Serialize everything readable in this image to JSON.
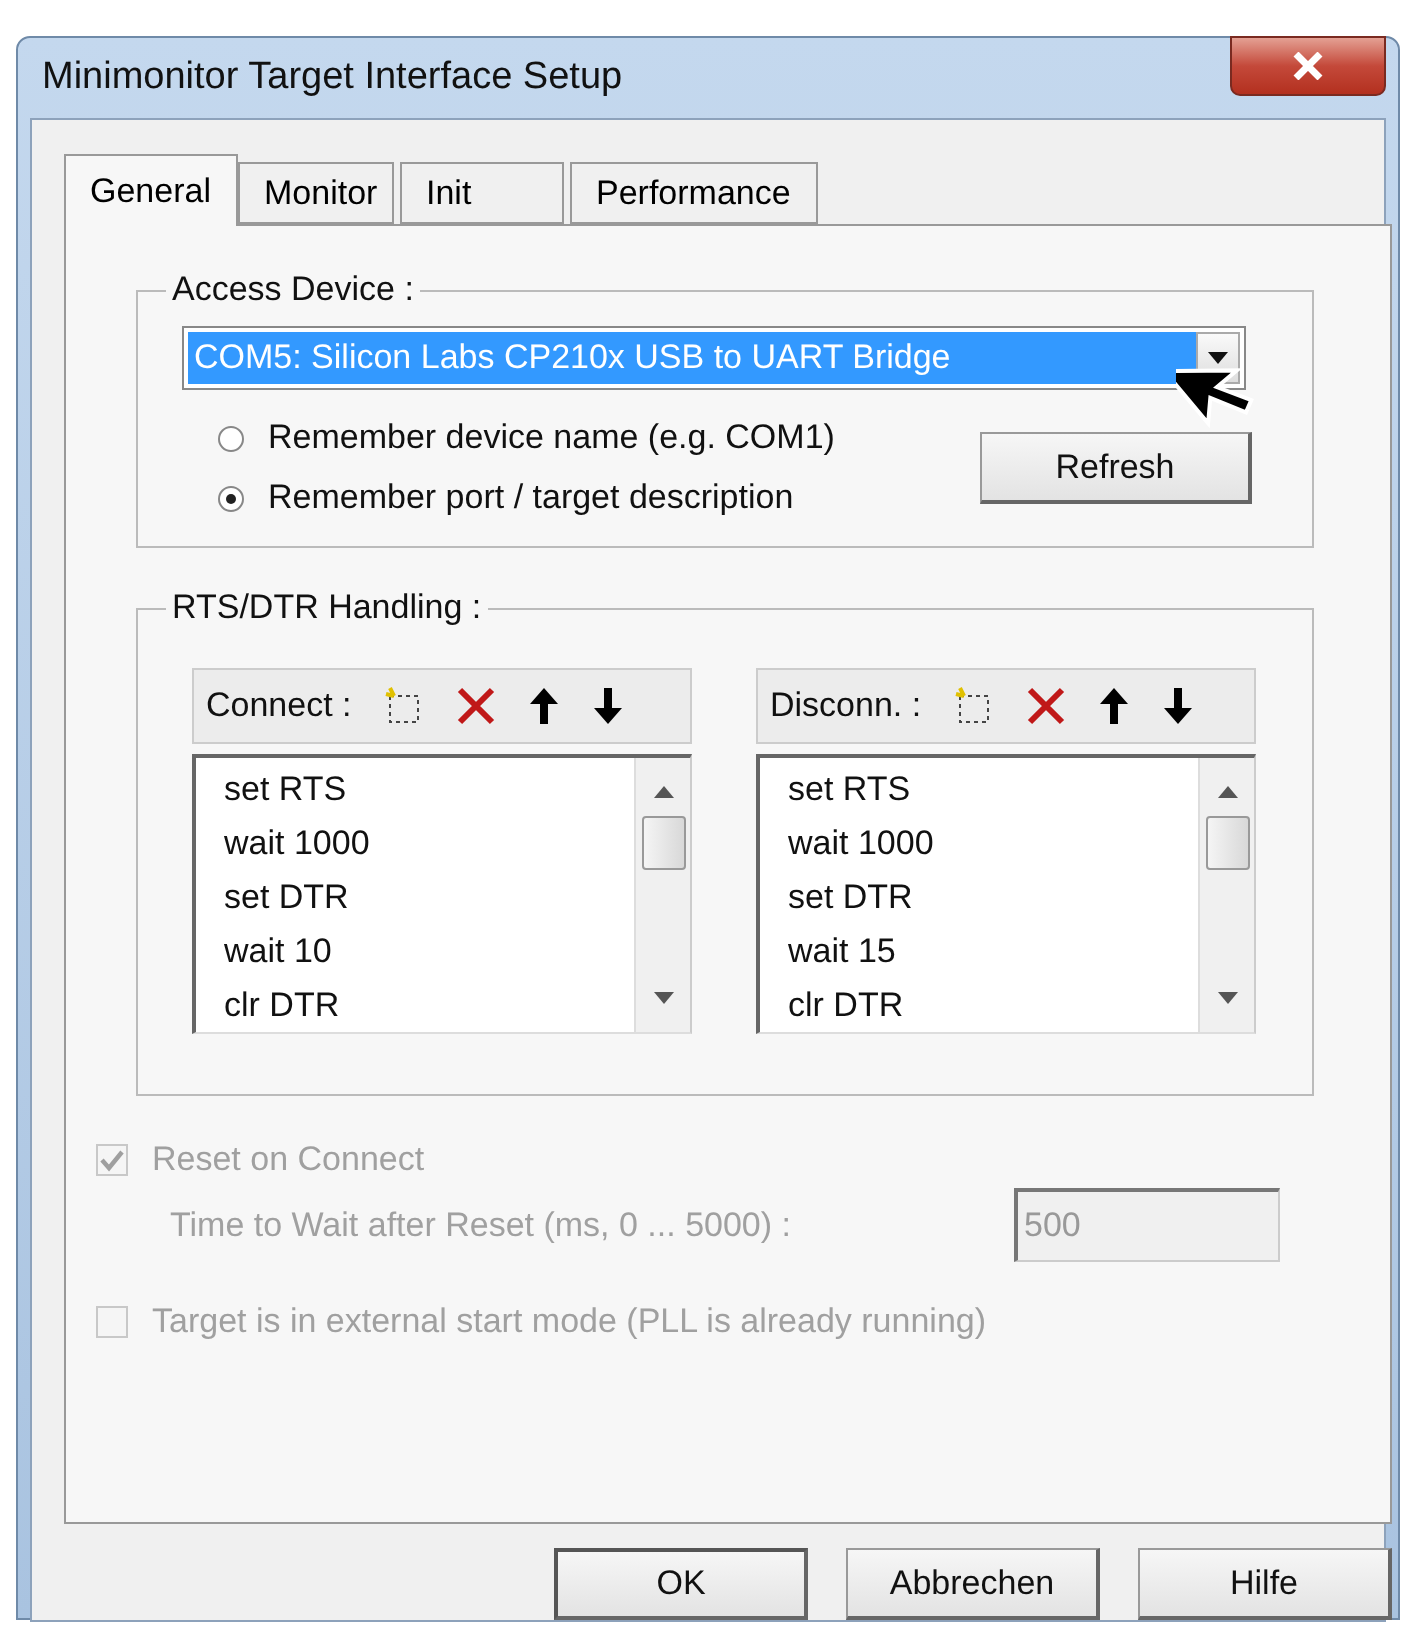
{
  "window": {
    "title": "Minimonitor Target Interface Setup"
  },
  "tabs": [
    {
      "label": "General",
      "selected": true
    },
    {
      "label": "Monitor",
      "selected": false
    },
    {
      "label": "Init",
      "selected": false
    },
    {
      "label": "Performance",
      "selected": false
    }
  ],
  "access_device": {
    "label": "Access Device :",
    "device": "COM5: Silicon Labs CP210x USB to UART Bridge",
    "radios": [
      {
        "label": "Remember device name (e.g. COM1)",
        "selected": false
      },
      {
        "label": "Remember port / target description",
        "selected": true
      }
    ],
    "refresh_button": "Refresh"
  },
  "rts_dtr": {
    "label": "RTS/DTR Handling :",
    "lists": [
      {
        "label": "Connect :",
        "items": [
          "set RTS",
          "wait 1000",
          "set DTR",
          "wait 10",
          "clr DTR"
        ]
      },
      {
        "label": "Disconn. :",
        "items": [
          "set RTS",
          "wait 1000",
          "set DTR",
          "wait 15",
          "clr DTR"
        ]
      }
    ]
  },
  "reset_on_connect": {
    "label": "Reset on Connect",
    "checked": true,
    "disabled": true
  },
  "wait_after_reset": {
    "label": "Time to Wait after Reset (ms, 0 ... 5000) :",
    "value": "500",
    "disabled": true
  },
  "external_start": {
    "label": "Target is in external start mode (PLL is already running)",
    "checked": false,
    "disabled": true
  },
  "buttons": [
    {
      "label": "OK",
      "default": true
    },
    {
      "label": "Abbrechen",
      "default": false
    },
    {
      "label": "Hilfe",
      "default": false
    }
  ]
}
